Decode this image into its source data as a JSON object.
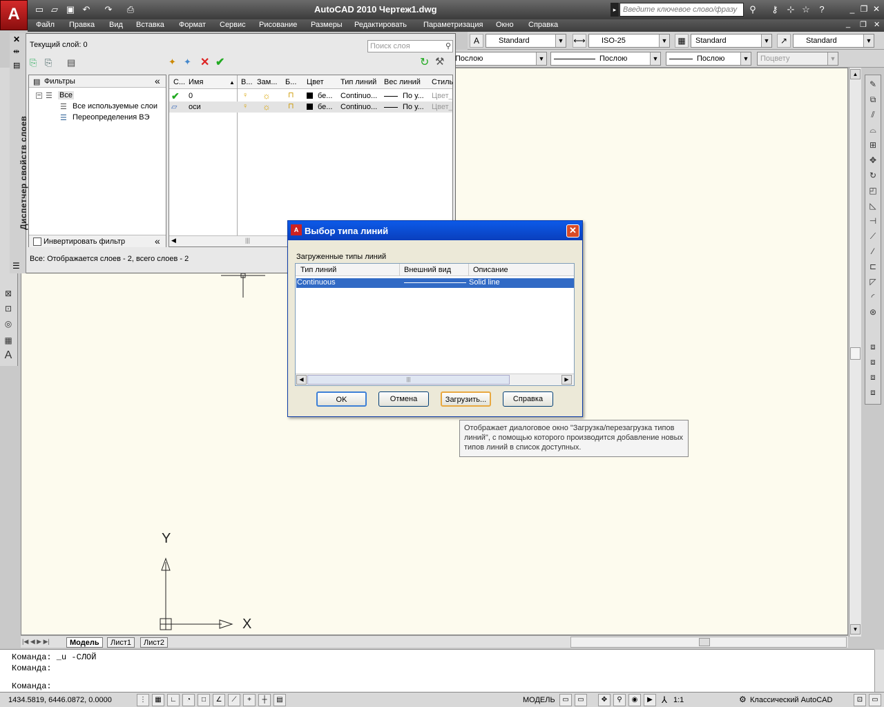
{
  "app": {
    "logo": "A",
    "title": "AutoCAD 2010    Чертеж1.dwg",
    "search_placeholder": "Введите ключевое слово/фразу"
  },
  "menu": [
    "Файл",
    "Правка",
    "Вид",
    "Вставка",
    "Формат",
    "Сервис",
    "Рисование",
    "Размеры",
    "Редактировать",
    "Параметризация",
    "Окно",
    "Справка"
  ],
  "styles_toolbar": {
    "text_style": "Standard",
    "dim_style": "ISO-25",
    "table_style": "Standard",
    "mleader_style": "Standard"
  },
  "props_toolbar": {
    "color": "Послою",
    "linetype": "Послою",
    "lineweight": "Послою",
    "plotstyle": "Поцвету"
  },
  "layer_manager": {
    "vertical_title": "Диспетчер свойств слоев",
    "current_layer": "Текущий слой: 0",
    "search_placeholder": "Поиск слоя",
    "filters_header": "Фильтры",
    "tree": [
      "Все",
      "Все используемые слои",
      "Переопределения ВЭ"
    ],
    "invert_filter": "Инвертировать фильтр",
    "columns": [
      "С...",
      "Имя",
      "В...",
      "Зам...",
      "Б...",
      "Цвет",
      "Тип линий",
      "Вес линий",
      "Стиль"
    ],
    "rows": [
      {
        "name": "0",
        "color": "бе...",
        "linetype": "Continuo...",
        "weight": "По у...",
        "style": "Цвет_"
      },
      {
        "name": "оси",
        "color": "бе...",
        "linetype": "Continuo...",
        "weight": "По у...",
        "style": "Цвет_"
      }
    ],
    "status": "Все: Отображается слоев - 2, всего слоев - 2"
  },
  "dialog": {
    "title": "Выбор типа линий",
    "group_label": "Загруженные типы линий",
    "columns": [
      "Тип линий",
      "Внешний вид",
      "Описание"
    ],
    "row": {
      "name": "Continuous",
      "description": "Solid line"
    },
    "buttons": {
      "ok": "OK",
      "cancel": "Отмена",
      "load": "Загрузить...",
      "help": "Справка"
    }
  },
  "tooltip": "Отображает диалоговое окно \"Загрузка/перезагрузка типов линий\", с помощью которого производится добавление новых типов линий в список доступных.",
  "canvas": {
    "axis_y": "Y",
    "axis_x": "X"
  },
  "tabs": [
    "Модель",
    "Лист1",
    "Лист2"
  ],
  "command": {
    "line1": "Команда:  _u -СЛОЙ",
    "line2": "Команда:",
    "line3": "Команда:"
  },
  "status": {
    "coords": "1434.5819, 6446.0872, 0.0000",
    "model": "МОДЕЛЬ",
    "scale": "1:1",
    "workspace": "Классический AutoCAD"
  }
}
